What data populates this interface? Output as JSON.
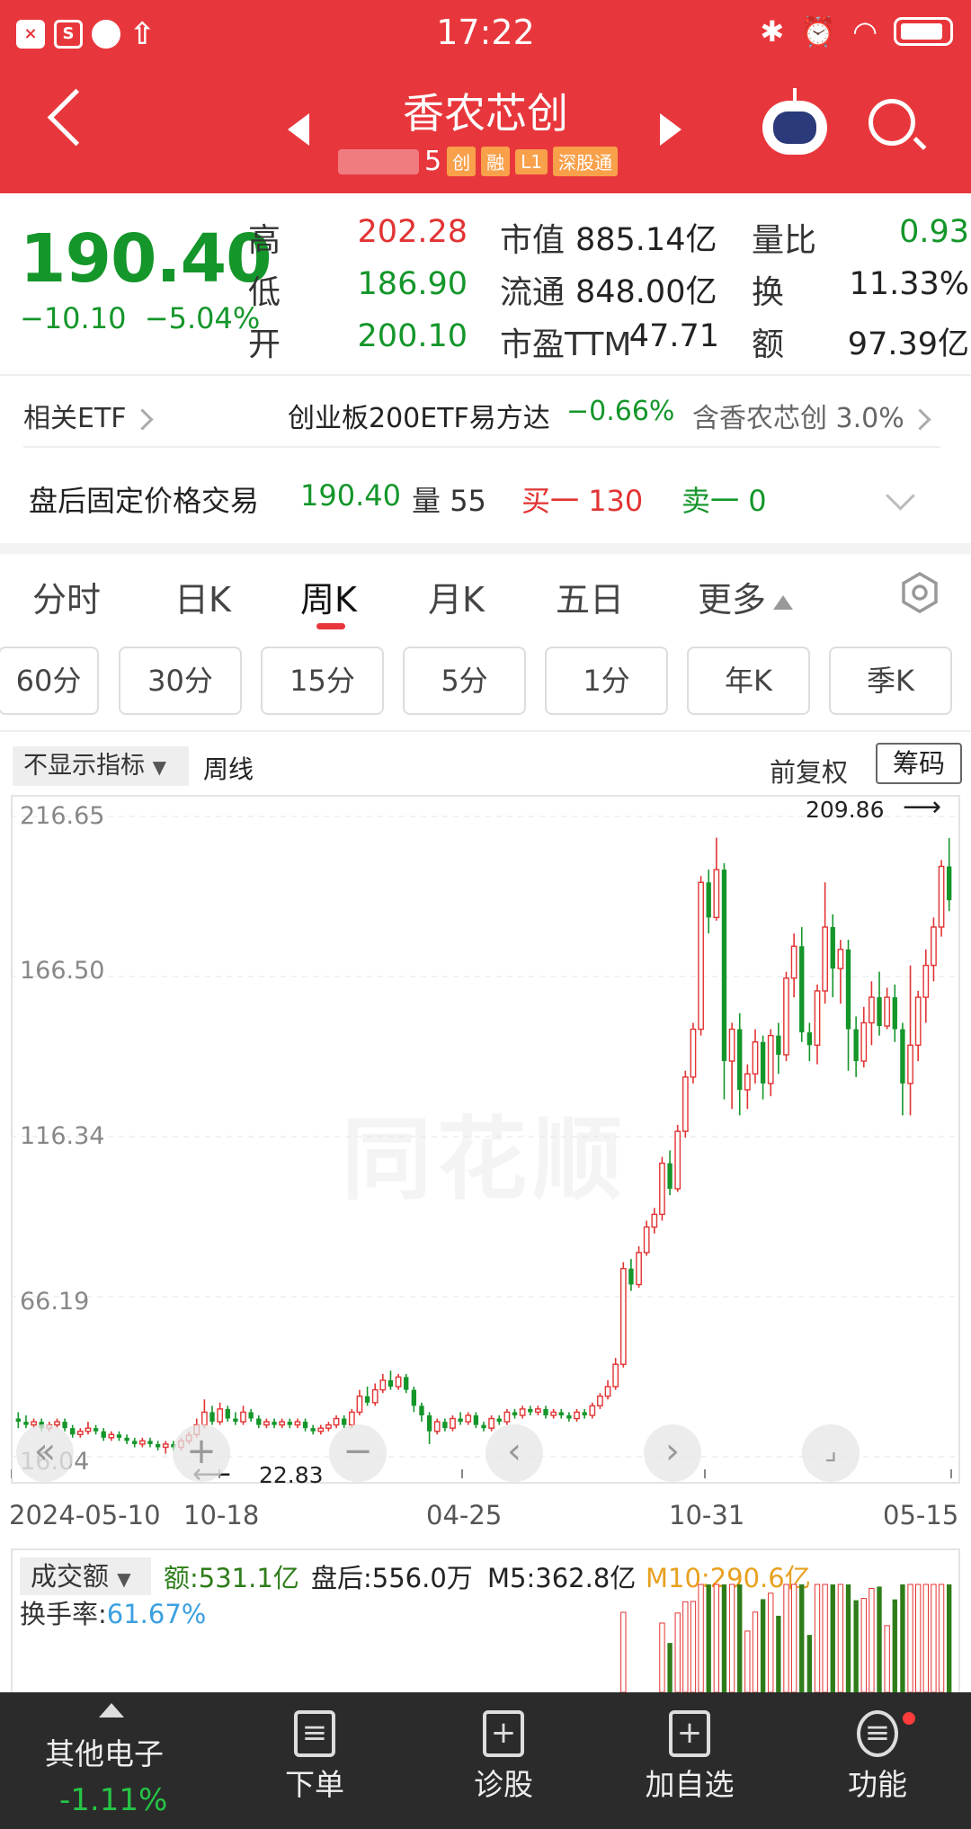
{
  "status": {
    "time": "17:22"
  },
  "header": {
    "stock_name": "香农芯创",
    "code": "5",
    "tags": [
      "创",
      "融",
      "L1",
      "深股通"
    ]
  },
  "quote": {
    "price": "190.40",
    "change": "−10.10",
    "change_pct": "−5.04%",
    "rows": [
      {
        "l1": "高",
        "v1": "202.28",
        "l2": "市值",
        "v2": "885.14亿",
        "l3": "量比",
        "v3": "0.93"
      },
      {
        "l1": "低",
        "v1": "186.90",
        "l2": "流通",
        "v2": "848.00亿",
        "l3": "换",
        "v3": "11.33%"
      },
      {
        "l1": "开",
        "v1": "200.10",
        "l2": "市盈TTM",
        "v2": "47.71",
        "l3": "额",
        "v3": "97.39亿"
      }
    ]
  },
  "etf": {
    "label": "相关ETF",
    "name": "创业板200ETF易方达",
    "change": "−0.66%",
    "holding": "含香农芯创 3.0%"
  },
  "after_hours": {
    "label": "盘后固定价格交易",
    "price": "190.40",
    "volume_label": "量",
    "volume": "55",
    "buy_label": "买一",
    "buy": "130",
    "sell_label": "卖一",
    "sell": "0"
  },
  "tabs": [
    "分时",
    "日K",
    "周K",
    "月K",
    "五日",
    "更多"
  ],
  "periods": [
    "60分",
    "30分",
    "15分",
    "5分",
    "1分",
    "年K",
    "季K"
  ],
  "chart_header": {
    "indicator": "不显示指标",
    "line_type": "周线",
    "adjust": "前复权",
    "chip": "筹码"
  },
  "chart_data": {
    "type": "candlestick",
    "y_ticks": [
      "216.65",
      "166.50",
      "116.34",
      "66.19",
      "16.04"
    ],
    "x_ticks": [
      "2024-05-10",
      "10-18",
      "04-25",
      "10-31",
      "05-15"
    ],
    "max_label": "209.86",
    "min_label": "22.83",
    "ylim": [
      16.04,
      216.65
    ],
    "candles": [
      [
        28,
        27,
        30,
        25
      ],
      [
        27,
        26,
        29,
        25
      ],
      [
        26,
        27,
        28,
        25
      ],
      [
        27,
        25,
        28,
        24
      ],
      [
        25,
        26,
        27,
        24
      ],
      [
        26,
        27,
        28,
        25
      ],
      [
        27,
        25,
        28,
        24
      ],
      [
        25,
        23,
        26,
        22
      ],
      [
        23,
        24,
        25,
        22
      ],
      [
        24,
        25,
        27,
        23
      ],
      [
        25,
        24,
        26,
        23
      ],
      [
        24,
        22,
        25,
        21
      ],
      [
        22,
        23,
        24,
        21
      ],
      [
        23,
        22,
        24,
        21
      ],
      [
        22,
        21,
        23,
        20
      ],
      [
        21,
        20,
        22,
        19
      ],
      [
        20,
        21,
        22,
        19
      ],
      [
        21,
        20,
        22,
        19
      ],
      [
        20,
        19,
        21,
        18
      ],
      [
        19,
        20,
        21,
        17
      ],
      [
        20,
        19,
        21,
        18
      ],
      [
        19,
        21,
        22,
        18
      ],
      [
        21,
        22.8,
        24,
        20
      ],
      [
        23,
        26,
        28,
        22
      ],
      [
        26,
        30,
        34,
        25
      ],
      [
        30,
        27,
        32,
        26
      ],
      [
        27,
        31,
        33,
        26
      ],
      [
        31,
        28,
        32,
        27
      ],
      [
        28,
        27,
        30,
        26
      ],
      [
        27,
        30,
        32,
        26
      ],
      [
        30,
        28,
        31,
        27
      ],
      [
        28,
        26,
        29,
        25
      ],
      [
        26,
        27,
        28,
        25
      ],
      [
        27,
        26,
        28,
        25
      ],
      [
        26,
        27,
        28,
        25
      ],
      [
        27,
        26,
        28,
        25
      ],
      [
        26,
        27,
        28,
        25
      ],
      [
        27,
        25,
        28,
        24
      ],
      [
        25,
        24,
        26,
        23
      ],
      [
        24,
        25,
        26,
        23
      ],
      [
        25,
        26,
        27,
        24
      ],
      [
        26,
        28,
        29,
        25
      ],
      [
        28,
        26,
        29,
        25
      ],
      [
        26,
        30,
        31,
        25
      ],
      [
        30,
        35,
        37,
        29
      ],
      [
        35,
        33,
        38,
        32
      ],
      [
        33,
        37,
        39,
        32
      ],
      [
        37,
        40,
        42,
        36
      ],
      [
        40,
        38,
        43,
        37
      ],
      [
        38,
        41,
        42,
        37
      ],
      [
        41,
        37,
        42,
        36
      ],
      [
        37,
        32,
        38,
        30
      ],
      [
        32,
        29,
        33,
        27
      ],
      [
        29,
        24,
        30,
        20
      ],
      [
        24,
        27,
        28,
        23
      ],
      [
        27,
        25,
        28,
        24
      ],
      [
        25,
        28,
        29,
        24
      ],
      [
        28,
        27,
        30,
        26
      ],
      [
        27,
        29,
        30,
        26
      ],
      [
        29,
        26,
        30,
        25
      ],
      [
        26,
        25,
        27,
        24
      ],
      [
        25,
        28,
        29,
        24
      ],
      [
        28,
        27,
        29,
        26
      ],
      [
        27,
        30,
        31,
        26
      ],
      [
        30,
        29,
        31,
        28
      ],
      [
        29,
        31,
        32,
        28
      ],
      [
        31,
        30,
        32,
        29
      ],
      [
        30,
        31,
        32,
        29
      ],
      [
        31,
        29,
        32,
        28
      ],
      [
        29,
        30,
        31,
        28
      ],
      [
        30,
        29,
        31,
        28
      ],
      [
        29,
        28,
        30,
        27
      ],
      [
        28,
        30,
        31,
        27
      ],
      [
        30,
        29,
        31,
        28
      ],
      [
        29,
        32,
        33,
        28
      ],
      [
        32,
        35,
        36,
        31
      ],
      [
        35,
        38,
        40,
        34
      ],
      [
        38,
        45,
        47,
        37
      ],
      [
        45,
        75,
        77,
        44
      ],
      [
        75,
        70,
        78,
        68
      ],
      [
        70,
        80,
        82,
        69
      ],
      [
        80,
        88,
        90,
        79
      ],
      [
        88,
        92,
        94,
        86
      ],
      [
        92,
        108,
        110,
        90
      ],
      [
        108,
        100,
        112,
        98
      ],
      [
        100,
        118,
        120,
        99
      ],
      [
        118,
        135,
        137,
        116
      ],
      [
        135,
        150,
        152,
        133
      ],
      [
        150,
        196,
        198,
        148
      ],
      [
        196,
        185,
        200,
        180
      ],
      [
        185,
        200,
        210,
        184
      ],
      [
        200,
        140,
        202,
        128
      ],
      [
        140,
        150,
        152,
        125
      ],
      [
        150,
        131,
        155,
        123
      ],
      [
        131,
        136,
        139,
        125
      ],
      [
        136,
        146,
        150,
        133
      ],
      [
        146,
        133,
        148,
        128
      ],
      [
        133,
        148,
        150,
        129
      ],
      [
        148,
        142,
        152,
        136
      ],
      [
        142,
        166,
        168,
        140
      ],
      [
        166,
        176,
        180,
        160
      ],
      [
        176,
        149,
        182,
        146
      ],
      [
        149,
        145,
        152,
        140
      ],
      [
        145,
        162,
        164,
        139
      ],
      [
        162,
        182,
        196,
        158
      ],
      [
        182,
        169,
        186,
        160
      ],
      [
        169,
        175,
        178,
        158
      ],
      [
        175,
        150,
        178,
        137
      ],
      [
        150,
        140,
        154,
        135
      ],
      [
        140,
        152,
        157,
        138
      ],
      [
        152,
        160,
        165,
        145
      ],
      [
        160,
        151,
        168,
        148
      ],
      [
        151,
        160,
        163,
        150
      ],
      [
        160,
        150,
        164,
        146
      ],
      [
        150,
        133,
        152,
        123
      ],
      [
        133,
        145,
        170,
        123
      ],
      [
        145,
        160,
        162,
        140
      ],
      [
        160,
        170,
        175,
        152
      ],
      [
        170,
        182,
        185,
        165
      ],
      [
        182,
        201,
        203,
        179
      ],
      [
        201,
        190.4,
        209.86,
        187
      ]
    ]
  },
  "volume": {
    "selector": "成交额",
    "amount": "额:531.1亿",
    "after": "盘后:556.0万",
    "m5": "M5:362.8亿",
    "m10": "M10:290.6亿",
    "turnover_label": "换手率:",
    "turnover": "61.67%"
  },
  "bottom": {
    "sector": "其他电子",
    "sector_chg": "-1.11%",
    "items": [
      "下单",
      "诊股",
      "加自选",
      "功能"
    ]
  },
  "colors": {
    "header": "#e8373c",
    "up": "#e23333",
    "down": "#14962a",
    "m10": "#e8a020",
    "turnover": "#3aa0e0"
  }
}
